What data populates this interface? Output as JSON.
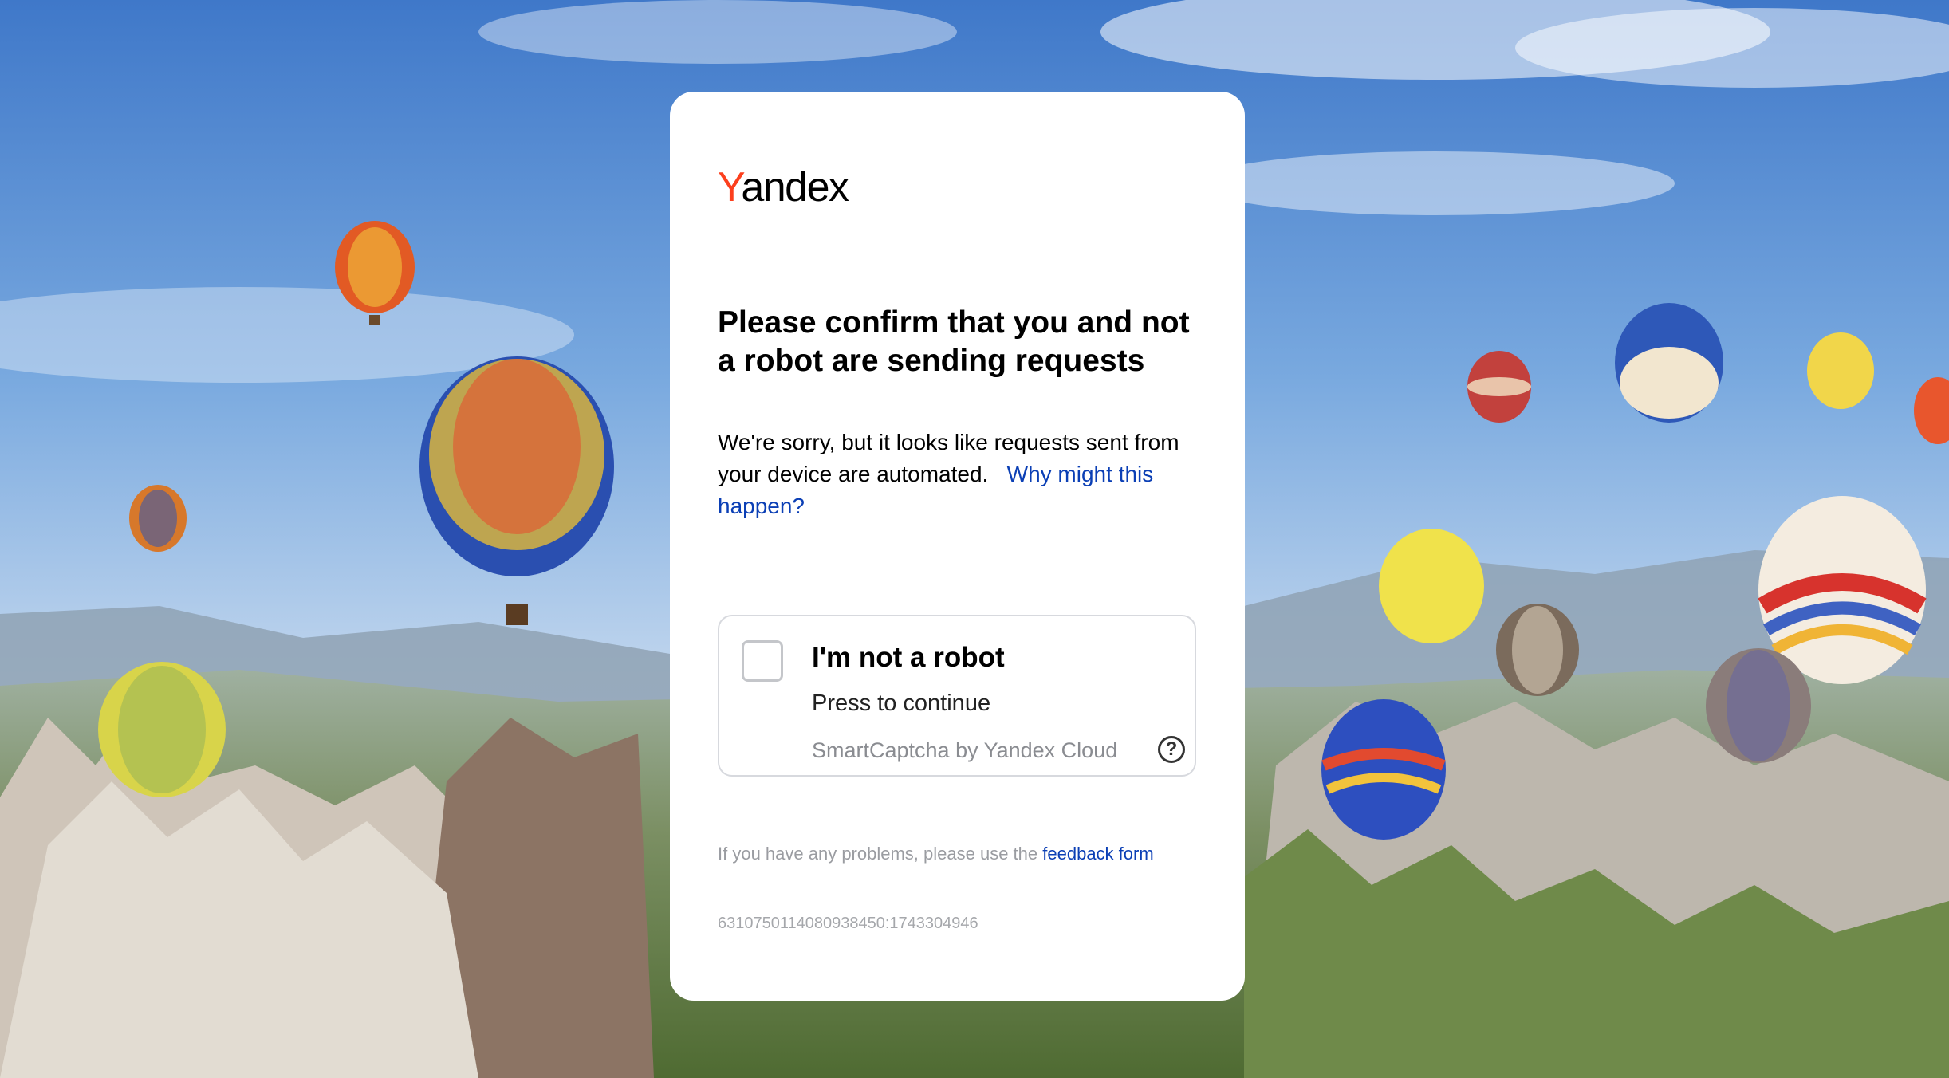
{
  "logo": {
    "first_letter": "Y",
    "rest": "andex"
  },
  "title": "Please confirm that you and not a robot are sending requests",
  "description": {
    "text": "We're sorry, but it looks like requests sent from your device are automated.",
    "link": "Why might this happen?"
  },
  "captcha": {
    "title": "I'm not a robot",
    "subtitle": "Press to continue",
    "brand": "SmartCaptcha by Yandex Cloud",
    "help_icon": "?"
  },
  "feedback": {
    "text": "If you have any problems, please use the",
    "link": "feedback form"
  },
  "request_id": "6310750114080938450:1743304946",
  "colors": {
    "brand_red": "#fc3f1d",
    "link_blue": "#0b3fb5",
    "card_bg": "#ffffff"
  }
}
